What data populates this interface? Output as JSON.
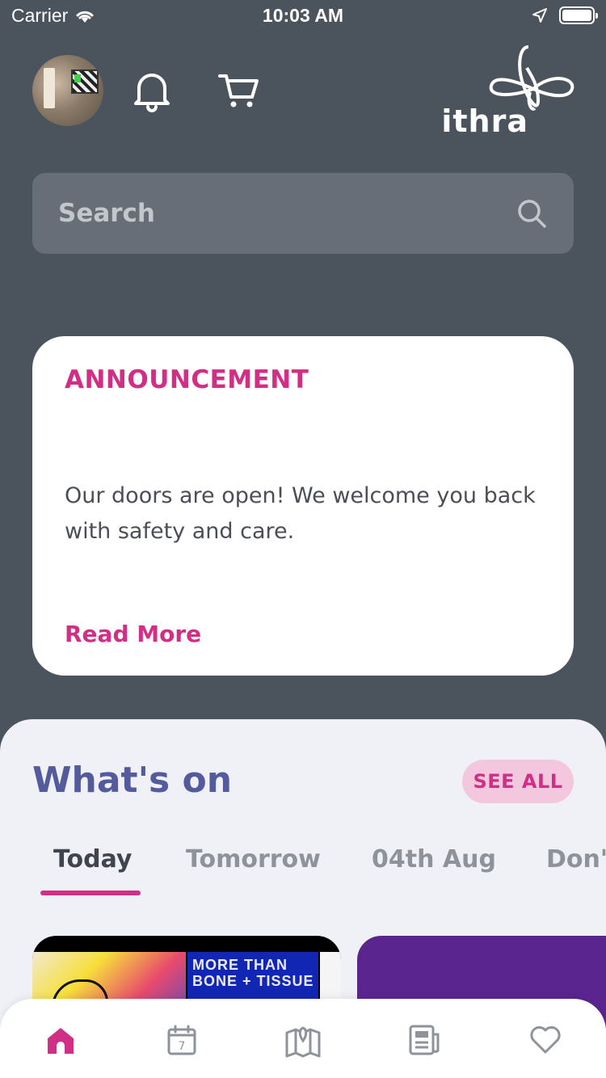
{
  "status_bar": {
    "carrier": "Carrier",
    "time": "10:03 AM"
  },
  "header": {
    "logo_text": "ithra",
    "icons": [
      "bell-icon",
      "cart-icon",
      "location-arrow-icon",
      "wifi-icon",
      "battery-icon"
    ]
  },
  "search": {
    "placeholder": "Search",
    "value": ""
  },
  "announcement": {
    "title": "ANNOUNCEMENT",
    "body": "Our doors are open! We welcome you back with safety and care.",
    "link": "Read More"
  },
  "whats_on": {
    "title": "What's on",
    "see_all": "SEE ALL",
    "tabs": [
      {
        "label": "Today",
        "active": true
      },
      {
        "label": "Tomorrow",
        "active": false
      },
      {
        "label": "04th Aug",
        "active": false
      },
      {
        "label": "Don't",
        "active": false
      }
    ],
    "card_text": "MORE THAN BONE + TISSUE"
  },
  "bottom_nav": {
    "items": [
      "home-icon",
      "calendar-icon",
      "map-icon",
      "news-icon",
      "heart-icon"
    ],
    "calendar_day": "7"
  },
  "colors": {
    "background": "#4b535d",
    "accent": "#d12f86",
    "title": "#535b9c",
    "panel": "#f0f1f6"
  }
}
